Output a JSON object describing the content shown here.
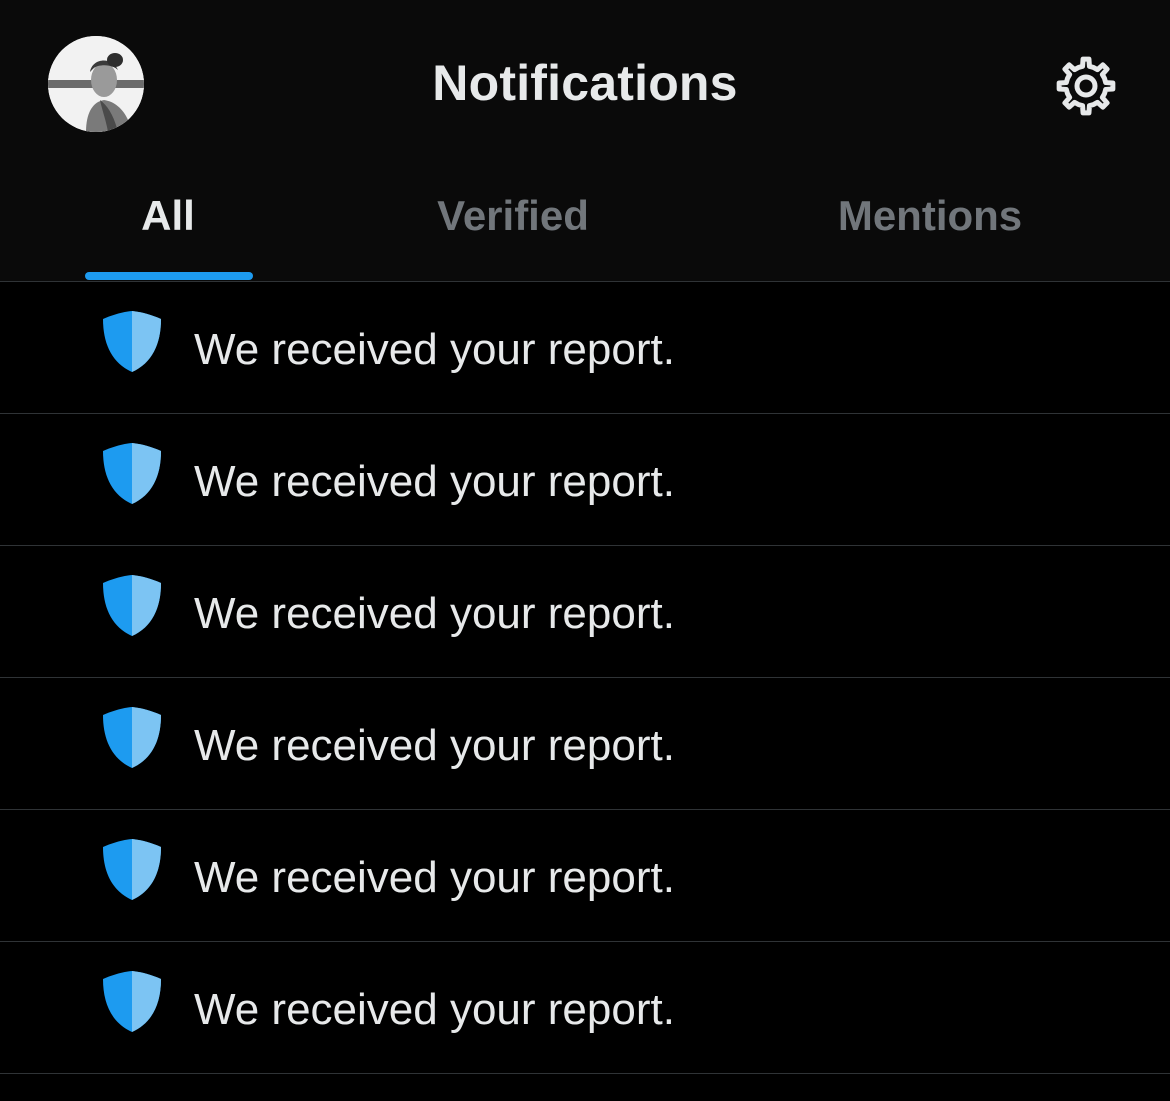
{
  "header": {
    "title": "Notifications",
    "avatar_icon": "user-avatar",
    "settings_icon": "gear-icon"
  },
  "tabs": [
    {
      "label": "All",
      "active": true
    },
    {
      "label": "Verified",
      "active": false
    },
    {
      "label": "Mentions",
      "active": false
    }
  ],
  "notifications": [
    {
      "icon": "shield-icon",
      "text": "We received your report."
    },
    {
      "icon": "shield-icon",
      "text": "We received your report."
    },
    {
      "icon": "shield-icon",
      "text": "We received your report."
    },
    {
      "icon": "shield-icon",
      "text": "We received your report."
    },
    {
      "icon": "shield-icon",
      "text": "We received your report."
    },
    {
      "icon": "shield-icon",
      "text": "We received your report."
    }
  ],
  "colors": {
    "accent": "#1d9bf0",
    "shield_light": "#7cc4f3",
    "background": "#000000",
    "text_primary": "#e7e9ea",
    "text_secondary": "#71767b",
    "divider": "#2f3336"
  }
}
